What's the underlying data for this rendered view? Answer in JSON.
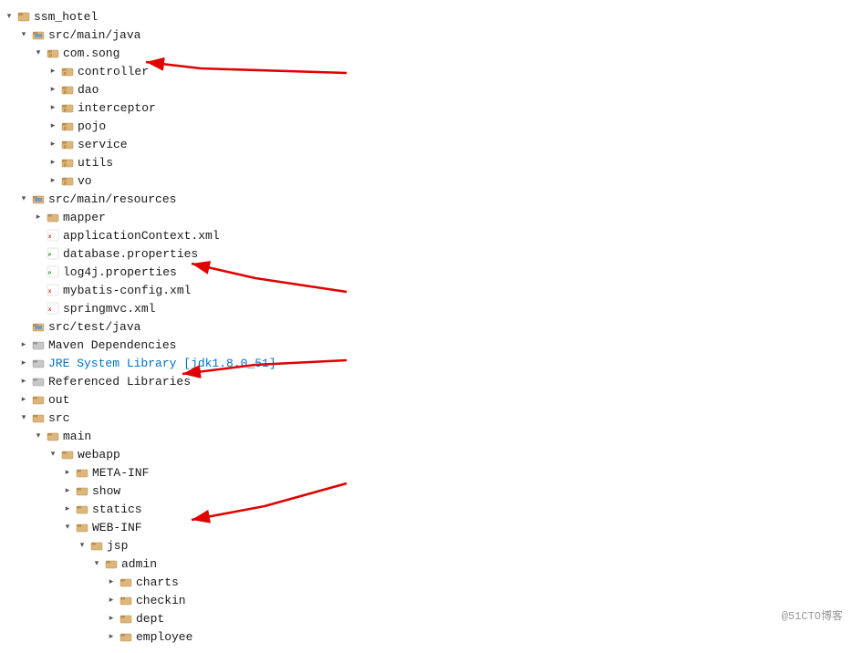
{
  "tree": {
    "title": "ssm_hotel",
    "items": [
      {
        "id": "root",
        "label": "ssm_hotel",
        "indent": 0,
        "toggle": "▼",
        "iconType": "project",
        "expanded": true
      },
      {
        "id": "src-main-java",
        "label": "src/main/java",
        "indent": 1,
        "toggle": "▼",
        "iconType": "folder-src",
        "expanded": true
      },
      {
        "id": "com-song",
        "label": "com.song",
        "indent": 2,
        "toggle": "▼",
        "iconType": "package",
        "expanded": true
      },
      {
        "id": "controller",
        "label": "controller",
        "indent": 3,
        "toggle": ">",
        "iconType": "package",
        "expanded": false
      },
      {
        "id": "dao",
        "label": "dao",
        "indent": 3,
        "toggle": ">",
        "iconType": "package",
        "expanded": false
      },
      {
        "id": "interceptor",
        "label": "interceptor",
        "indent": 3,
        "toggle": ">",
        "iconType": "package",
        "expanded": false
      },
      {
        "id": "pojo",
        "label": "pojo",
        "indent": 3,
        "toggle": ">",
        "iconType": "package",
        "expanded": false
      },
      {
        "id": "service",
        "label": "service",
        "indent": 3,
        "toggle": ">",
        "iconType": "package",
        "expanded": false
      },
      {
        "id": "utils",
        "label": "utils",
        "indent": 3,
        "toggle": ">",
        "iconType": "package",
        "expanded": false
      },
      {
        "id": "vo",
        "label": "vo",
        "indent": 3,
        "toggle": ">",
        "iconType": "package",
        "expanded": false
      },
      {
        "id": "src-main-resources",
        "label": "src/main/resources",
        "indent": 1,
        "toggle": "▼",
        "iconType": "folder-src",
        "expanded": true
      },
      {
        "id": "mapper",
        "label": "mapper",
        "indent": 2,
        "toggle": ">",
        "iconType": "folder",
        "expanded": false
      },
      {
        "id": "applicationContext",
        "label": "applicationContext.xml",
        "indent": 2,
        "toggle": "",
        "iconType": "xml",
        "expanded": false
      },
      {
        "id": "database-properties",
        "label": "database.properties",
        "indent": 2,
        "toggle": "",
        "iconType": "properties",
        "expanded": false
      },
      {
        "id": "log4j-properties",
        "label": "log4j.properties",
        "indent": 2,
        "toggle": "",
        "iconType": "properties",
        "expanded": false
      },
      {
        "id": "mybatis-config",
        "label": "mybatis-config.xml",
        "indent": 2,
        "toggle": "",
        "iconType": "xml",
        "expanded": false
      },
      {
        "id": "springmvc-xml",
        "label": "springmvc.xml",
        "indent": 2,
        "toggle": "",
        "iconType": "xml",
        "expanded": false
      },
      {
        "id": "src-test-java",
        "label": "src/test/java",
        "indent": 1,
        "toggle": "",
        "iconType": "folder-src",
        "expanded": false
      },
      {
        "id": "maven-deps",
        "label": "Maven Dependencies",
        "indent": 1,
        "toggle": ">",
        "iconType": "lib",
        "expanded": false
      },
      {
        "id": "jre-system",
        "label": "JRE System Library [jdk1.8.0_51]",
        "indent": 1,
        "toggle": ">",
        "iconType": "lib",
        "expanded": false
      },
      {
        "id": "referenced-libs",
        "label": "Referenced Libraries",
        "indent": 1,
        "toggle": ">",
        "iconType": "lib",
        "expanded": false
      },
      {
        "id": "out",
        "label": "out",
        "indent": 1,
        "toggle": ">",
        "iconType": "folder",
        "expanded": false
      },
      {
        "id": "src",
        "label": "src",
        "indent": 1,
        "toggle": "▼",
        "iconType": "folder",
        "expanded": true
      },
      {
        "id": "main",
        "label": "main",
        "indent": 2,
        "toggle": "▼",
        "iconType": "folder",
        "expanded": true
      },
      {
        "id": "webapp",
        "label": "webapp",
        "indent": 3,
        "toggle": "▼",
        "iconType": "folder",
        "expanded": true
      },
      {
        "id": "meta-inf",
        "label": "META-INF",
        "indent": 4,
        "toggle": ">",
        "iconType": "folder",
        "expanded": false
      },
      {
        "id": "show",
        "label": "show",
        "indent": 4,
        "toggle": ">",
        "iconType": "folder",
        "expanded": false
      },
      {
        "id": "statics",
        "label": "statics",
        "indent": 4,
        "toggle": ">",
        "iconType": "folder",
        "expanded": false
      },
      {
        "id": "web-inf",
        "label": "WEB-INF",
        "indent": 4,
        "toggle": "▼",
        "iconType": "folder",
        "expanded": true
      },
      {
        "id": "jsp",
        "label": "jsp",
        "indent": 5,
        "toggle": "▼",
        "iconType": "folder",
        "expanded": true
      },
      {
        "id": "admin",
        "label": "admin",
        "indent": 6,
        "toggle": "▼",
        "iconType": "folder",
        "expanded": true
      },
      {
        "id": "charts",
        "label": "charts",
        "indent": 7,
        "toggle": ">",
        "iconType": "folder",
        "expanded": false
      },
      {
        "id": "checkin",
        "label": "checkin",
        "indent": 7,
        "toggle": ">",
        "iconType": "folder",
        "expanded": false
      },
      {
        "id": "dept",
        "label": "dept",
        "indent": 7,
        "toggle": ">",
        "iconType": "folder",
        "expanded": false
      },
      {
        "id": "employee",
        "label": "employee",
        "indent": 7,
        "toggle": ">",
        "iconType": "folder",
        "expanded": false
      }
    ]
  },
  "watermark": "@51CTO博客"
}
